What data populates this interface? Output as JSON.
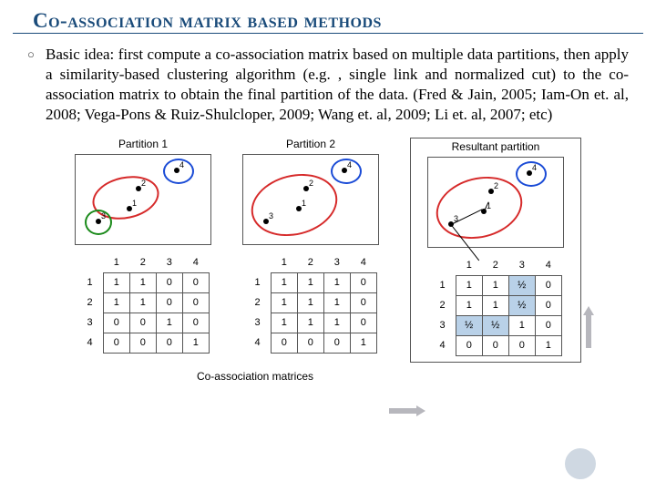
{
  "title": "Co-association matrix based methods",
  "bullet_marker": "○",
  "bullet_text": "Basic idea: first compute a co-association matrix based on multiple data partitions, then apply a similarity-based clustering algorithm (e.g. , single link and normalized cut) to the co-association matrix to obtain the final partition of the data. (Fred & Jain, 2005; Iam-On et. al, 2008; Vega-Pons & Ruiz-Shulcloper, 2009; Wang et. al, 2009; Li et. al, 2007; etc)",
  "panels": {
    "p1": {
      "title": "Partition 1"
    },
    "p2": {
      "title": "Partition 2"
    },
    "pr": {
      "title": "Resultant partition"
    }
  },
  "point_labels": {
    "a": "1",
    "b": "2",
    "c": "3",
    "d": "4"
  },
  "headers": [
    "1",
    "2",
    "3",
    "4"
  ],
  "chart_data": [
    {
      "type": "table",
      "title": "Partition 1 co-association",
      "categories": [
        "1",
        "2",
        "3",
        "4"
      ],
      "series": [
        {
          "name": "1",
          "values": [
            "1",
            "1",
            "0",
            "0"
          ]
        },
        {
          "name": "2",
          "values": [
            "1",
            "1",
            "0",
            "0"
          ]
        },
        {
          "name": "3",
          "values": [
            "0",
            "0",
            "1",
            "0"
          ]
        },
        {
          "name": "4",
          "values": [
            "0",
            "0",
            "0",
            "1"
          ]
        }
      ]
    },
    {
      "type": "table",
      "title": "Partition 2 co-association",
      "categories": [
        "1",
        "2",
        "3",
        "4"
      ],
      "series": [
        {
          "name": "1",
          "values": [
            "1",
            "1",
            "1",
            "0"
          ]
        },
        {
          "name": "2",
          "values": [
            "1",
            "1",
            "1",
            "0"
          ]
        },
        {
          "name": "3",
          "values": [
            "1",
            "1",
            "1",
            "0"
          ]
        },
        {
          "name": "4",
          "values": [
            "0",
            "0",
            "0",
            "1"
          ]
        }
      ]
    },
    {
      "type": "table",
      "title": "Resultant co-association",
      "categories": [
        "1",
        "2",
        "3",
        "4"
      ],
      "series": [
        {
          "name": "1",
          "values": [
            "1",
            "1",
            "½",
            "0"
          ]
        },
        {
          "name": "2",
          "values": [
            "1",
            "1",
            "½",
            "0"
          ]
        },
        {
          "name": "3",
          "values": [
            "½",
            "½",
            "1",
            "0"
          ]
        },
        {
          "name": "4",
          "values": [
            "0",
            "0",
            "0",
            "1"
          ]
        }
      ],
      "highlighted_cells": [
        [
          0,
          2
        ],
        [
          1,
          2
        ],
        [
          2,
          0
        ],
        [
          2,
          1
        ]
      ]
    }
  ],
  "caption": "Co-association matrices"
}
